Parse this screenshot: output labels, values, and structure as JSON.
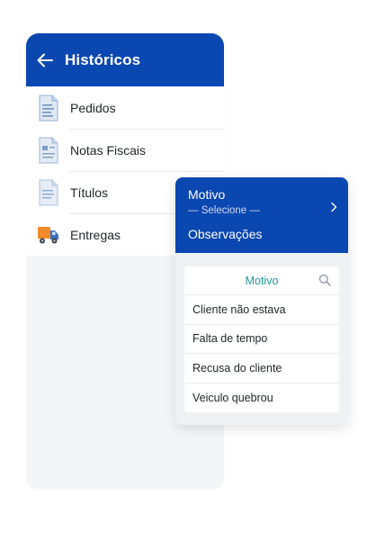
{
  "header": {
    "title": "Históricos",
    "back_icon": "back-arrow-icon",
    "color": "#0b47b0"
  },
  "menu": {
    "items": [
      {
        "label": "Pedidos",
        "icon": "document-icon"
      },
      {
        "label": "Notas Fiscais",
        "icon": "invoice-icon"
      },
      {
        "label": "Títulos",
        "icon": "document-icon"
      },
      {
        "label": "Entregas",
        "icon": "truck-icon"
      }
    ]
  },
  "overlay": {
    "motivo_label": "Motivo",
    "select_placeholder": "— Selecione —",
    "observacoes_label": "Observações",
    "search_title": "Motivo",
    "options": [
      "Cliente não estava",
      "Falta de tempo",
      "Recusa do cliente",
      "Veiculo quebrou"
    ],
    "accent": "#1e9a96"
  }
}
